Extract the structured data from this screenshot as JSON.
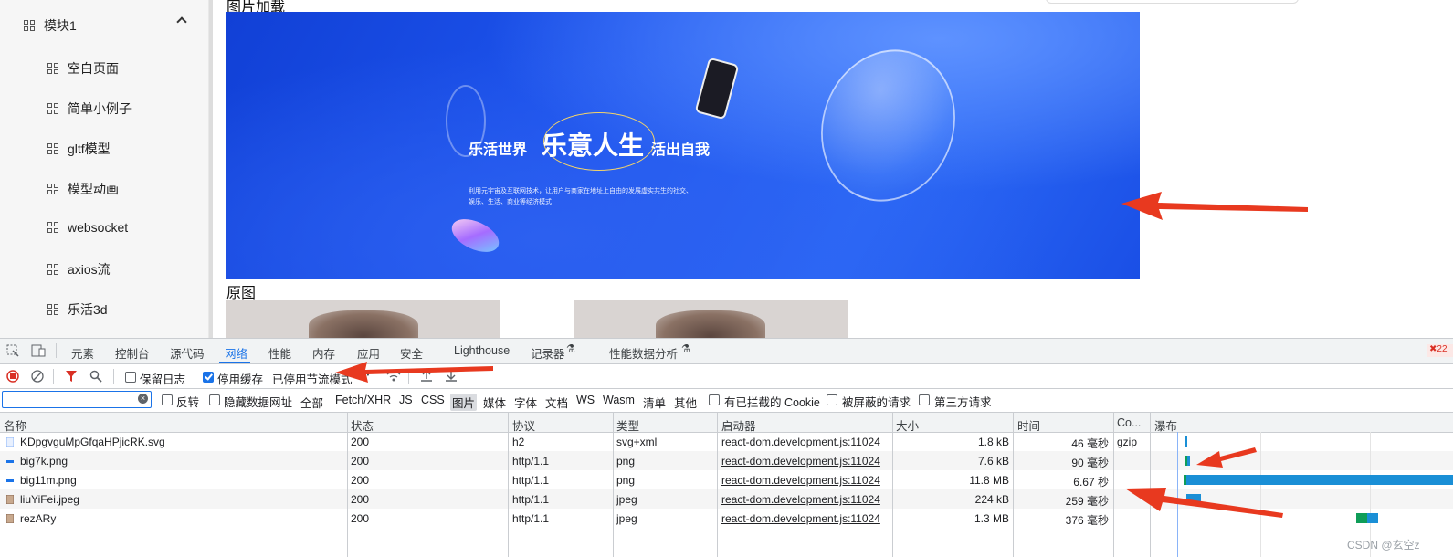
{
  "sidebar": {
    "group_label": "模块1",
    "items": [
      {
        "label": "空白页面"
      },
      {
        "label": "简单小例子"
      },
      {
        "label": "gltf模型"
      },
      {
        "label": "模型动画"
      },
      {
        "label": "websocket"
      },
      {
        "label": "axios流"
      },
      {
        "label": "乐活3d"
      }
    ]
  },
  "content": {
    "section1_title": "图片加载",
    "section2_title": "原图",
    "banner": {
      "text_left": "乐活世界",
      "text_main": "乐意人生",
      "text_right": "活出自我",
      "desc_line1": "利用元宇宙及互联网技术，让用户与商家在地址上自由的发展虚实共生的社交、",
      "desc_line2": "娱乐、生活、商业等经济模式"
    }
  },
  "devtools": {
    "tabs": [
      "元素",
      "控制台",
      "源代码",
      "网络",
      "性能",
      "内存",
      "应用",
      "安全",
      "Lighthouse",
      "记录器",
      "性能数据分析"
    ],
    "active_tab": "网络",
    "error_count": "22",
    "toolbar": {
      "preserve_log_label": "保留日志",
      "preserve_log_checked": false,
      "disable_cache_label": "停用缓存",
      "disable_cache_checked": true,
      "throttle_value": "已停用节流模式"
    },
    "filter": {
      "value": "",
      "invert_label": "反转",
      "hide_data_urls_label": "隐藏数据网址",
      "types": [
        "全部",
        "Fetch/XHR",
        "JS",
        "CSS",
        "图片",
        "媒体",
        "字体",
        "文档",
        "WS",
        "Wasm",
        "清单",
        "其他"
      ],
      "selected_type": "图片",
      "blocked_cookies_label": "有已拦截的 Cookie",
      "blocked_requests_label": "被屏蔽的请求",
      "third_party_label": "第三方请求"
    },
    "columns": [
      "名称",
      "状态",
      "协议",
      "类型",
      "启动器",
      "大小",
      "时间",
      "Co...",
      "瀑布"
    ],
    "rows": [
      {
        "name": "KDpgvguMpGfqaHPjicRK.svg",
        "status": "200",
        "protocol": "h2",
        "type": "svg+xml",
        "initiator": "react-dom.development.js:11024",
        "size": "1.8 kB",
        "time": "46 毫秒",
        "content_encoding": "gzip",
        "icon": "svg-file-icon"
      },
      {
        "name": "big7k.png",
        "status": "200",
        "protocol": "http/1.1",
        "type": "png",
        "initiator": "react-dom.development.js:11024",
        "size": "7.6 kB",
        "time": "90 毫秒",
        "content_encoding": "",
        "icon": "image-file-icon"
      },
      {
        "name": "big11m.png",
        "status": "200",
        "protocol": "http/1.1",
        "type": "png",
        "initiator": "react-dom.development.js:11024",
        "size": "11.8 MB",
        "time": "6.67 秒",
        "content_encoding": "",
        "icon": "image-file-icon"
      },
      {
        "name": "liuYiFei.jpeg",
        "status": "200",
        "protocol": "http/1.1",
        "type": "jpeg",
        "initiator": "react-dom.development.js:11024",
        "size": "224 kB",
        "time": "259 毫秒",
        "content_encoding": "",
        "icon": "photo-file-icon"
      },
      {
        "name": "rezARy",
        "status": "200",
        "protocol": "http/1.1",
        "type": "jpeg",
        "initiator": "react-dom.development.js:11024",
        "size": "1.3 MB",
        "time": "376 毫秒",
        "content_encoding": "",
        "icon": "photo-file-icon"
      }
    ]
  },
  "watermark": "CSDN @玄空z",
  "colors": {
    "accent": "#1a73e8",
    "annotation": "#e8391f",
    "waterfall_waiting": "#0f9d58",
    "waterfall_download": "#1a8fd6"
  }
}
